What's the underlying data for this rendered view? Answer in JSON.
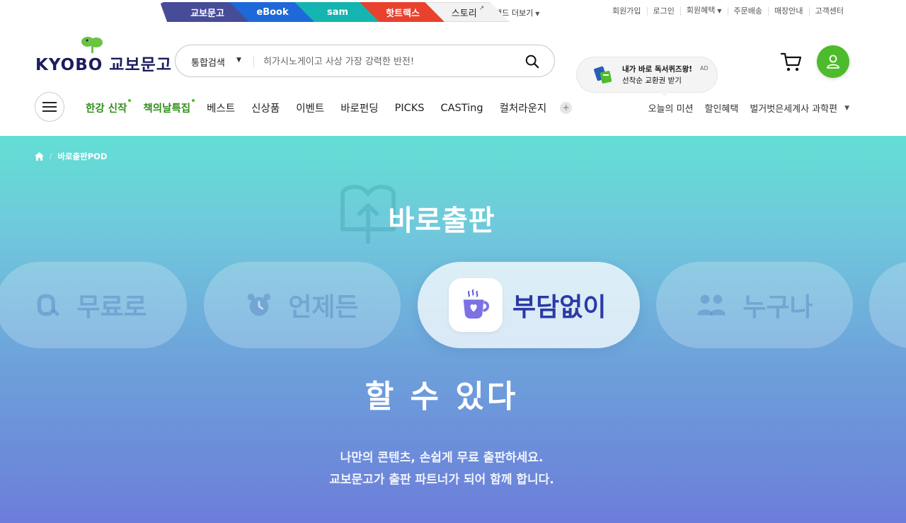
{
  "brand_tabs": [
    "교보문고",
    "eBook",
    "sam",
    "핫트랙스",
    "스토리"
  ],
  "brand_more": "브랜드 더보기",
  "util_links": [
    "회원가입",
    "로그인",
    "회원혜택",
    "주문배송",
    "매장안내",
    "고객센터"
  ],
  "logo": {
    "text": "KYOBO 교보문고"
  },
  "search": {
    "scope": "통합검색",
    "placeholder": "히가시노게이고 사상 가장 강력한 반전!"
  },
  "ad": {
    "line1": "내가 바로 독서퀴즈왕!",
    "tag": "AD",
    "line2": "선착순 교환권 받기"
  },
  "gnb": {
    "items": [
      "한강 신작",
      "책의날특집",
      "베스트",
      "신상품",
      "이벤트",
      "바로펀딩",
      "PICKS",
      "CASTing",
      "컬처라운지"
    ],
    "plus": "+",
    "right": [
      "오늘의 미션",
      "할인혜택",
      "벌거벗은세계사 과학편"
    ]
  },
  "breadcrumb": {
    "current": "바로출판POD",
    "sep": "/"
  },
  "hero": {
    "title": "바로출판",
    "pills": [
      "무료로",
      "언제든",
      "부담없이",
      "누구나"
    ],
    "subtitle": "할 수 있다",
    "desc_line1": "나만의 콘텐츠, 손쉽게 무료 출판하세요.",
    "desc_line2": "교보문고가 출판 파트너가 되어 함께 합니다."
  },
  "colors": {
    "brand_green": "#4dbb2b",
    "logo_navy": "#1c1d5e",
    "active_text": "#2c3aa5",
    "hero_top": "#62dfd4",
    "hero_bottom": "#6c7dda"
  }
}
